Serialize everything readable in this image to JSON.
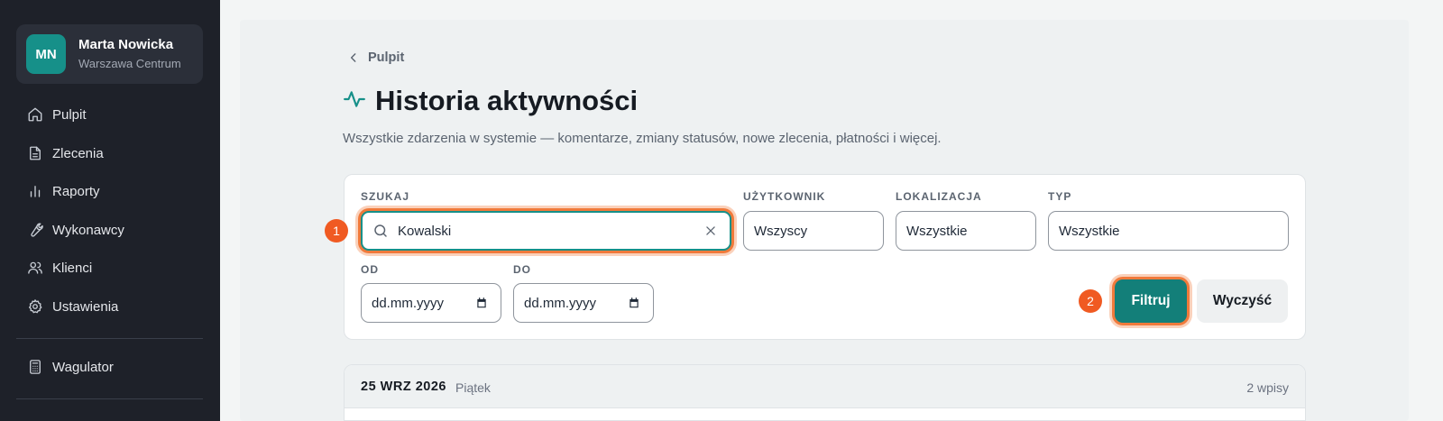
{
  "sidebar": {
    "user": {
      "initials": "MN",
      "name": "Marta Nowicka",
      "location": "Warszawa Centrum"
    },
    "items": [
      {
        "label": "Pulpit",
        "icon": "home-icon"
      },
      {
        "label": "Zlecenia",
        "icon": "document-icon"
      },
      {
        "label": "Raporty",
        "icon": "bar-chart-icon"
      },
      {
        "label": "Wykonawcy",
        "icon": "wrench-icon"
      },
      {
        "label": "Klienci",
        "icon": "users-icon"
      },
      {
        "label": "Ustawienia",
        "icon": "gear-icon"
      }
    ],
    "extra_items": [
      {
        "label": "Wagulator",
        "icon": "calculator-icon"
      }
    ]
  },
  "breadcrumb": {
    "label": "Pulpit"
  },
  "header": {
    "icon": "activity-pulse-icon",
    "title": "Historia aktywności",
    "subtitle": "Wszystkie zdarzenia w systemie — komentarze, zmiany statusów, nowe zlecenia, płatności i więcej."
  },
  "filters": {
    "search": {
      "label": "SZUKAJ",
      "value": "Kowalski"
    },
    "user": {
      "label": "UŻYTKOWNIK",
      "value": "Wszyscy"
    },
    "location": {
      "label": "LOKALIZACJA",
      "value": "Wszystkie"
    },
    "type": {
      "label": "TYP",
      "value": "Wszystkie"
    },
    "from": {
      "label": "OD",
      "placeholder": "dd.mm.yyyy"
    },
    "to": {
      "label": "DO",
      "placeholder": "dd.mm.yyyy"
    },
    "filter_button": "Filtruj",
    "clear_button": "Wyczyść"
  },
  "annotations": {
    "badge_1": "1",
    "badge_2": "2"
  },
  "day_groups": [
    {
      "date": "25 WRZ 2026",
      "weekday": "Piątek",
      "count": "2 wpisy"
    }
  ],
  "colors": {
    "accent": "#169089",
    "primary_button": "#137f79",
    "highlight": "#f05a22",
    "sidebar_bg": "#1e2129"
  }
}
